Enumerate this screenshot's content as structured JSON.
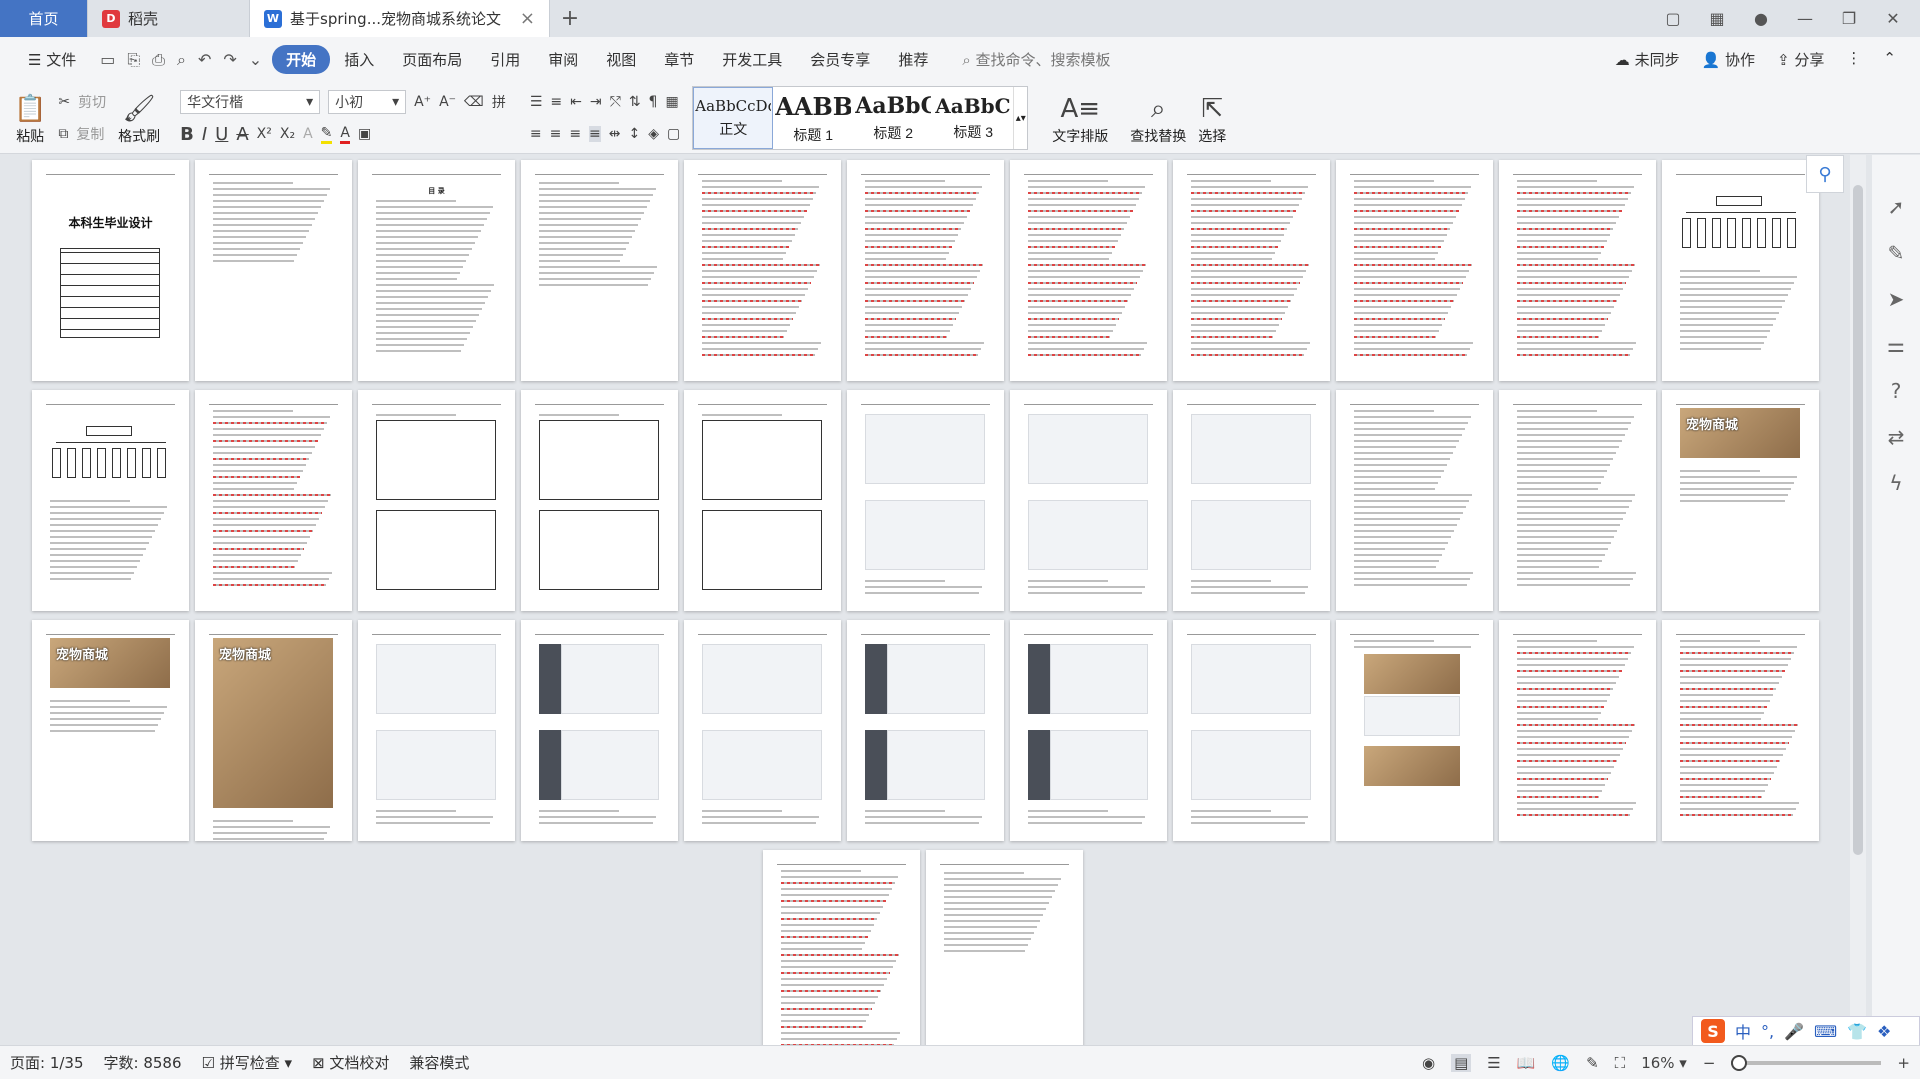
{
  "tabs": {
    "home": "首页",
    "shell": "稻壳",
    "doc": "基于spring...宠物商城系统论文"
  },
  "menu": {
    "file": "文件",
    "items": [
      "开始",
      "插入",
      "页面布局",
      "引用",
      "审阅",
      "视图",
      "章节",
      "开发工具",
      "会员专享",
      "推荐"
    ],
    "search": "查找命令、搜索模板",
    "sync": "未同步",
    "collab": "协作",
    "share": "分享"
  },
  "ribbon": {
    "paste": "粘贴",
    "cut": "剪切",
    "copy": "复制",
    "format_painter": "格式刷",
    "font_name": "华文行楷",
    "font_size": "小初",
    "styles": [
      {
        "sample": "AaBbCcDd",
        "name": "正文"
      },
      {
        "sample": "AABB",
        "name": "标题 1"
      },
      {
        "sample": "AaBbC",
        "name": "标题 2"
      },
      {
        "sample": "AaBbCc",
        "name": "标题 3"
      }
    ],
    "text_layout": "文字排版",
    "find_replace": "查找替换",
    "select": "选择"
  },
  "pages": {
    "cover_title": "本科生毕业设计",
    "toc_title": "目 录",
    "pet_banner": "宠物商城"
  },
  "status": {
    "page": "页面: 1/35",
    "words": "字数: 8586",
    "spell": "拼写检查",
    "proof": "文档校对",
    "compat": "兼容模式",
    "zoom": "16%"
  },
  "ime": {
    "lang": "中"
  },
  "colors": {
    "accent": "#4474c4",
    "shell_red": "#e0393e",
    "wps_blue": "#2b6fd6"
  }
}
